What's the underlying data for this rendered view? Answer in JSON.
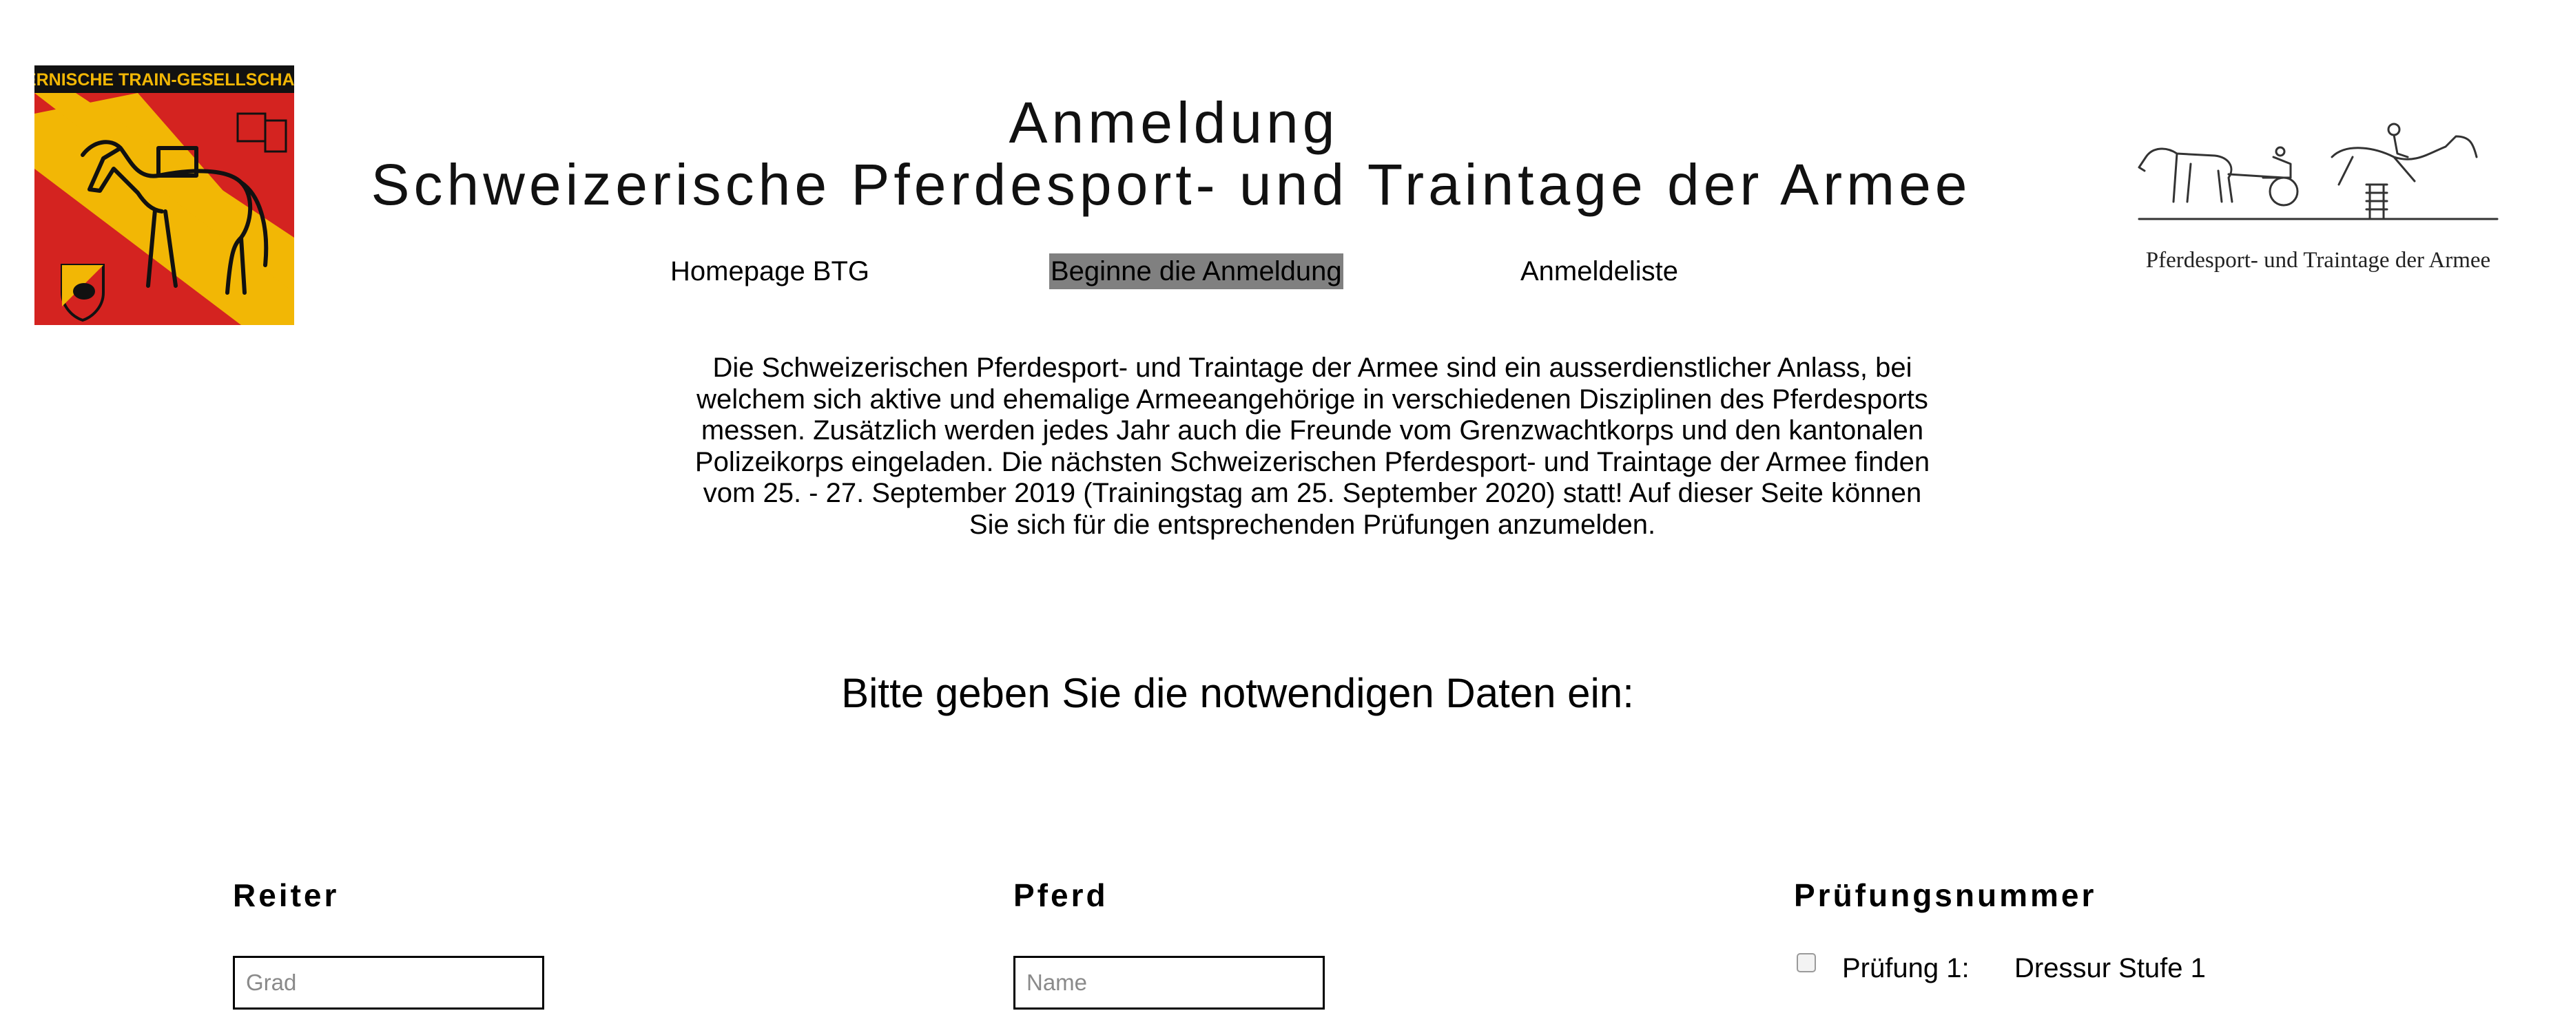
{
  "logo_left": {
    "banner_text": "BERNISCHE TRAIN-GESELLSCHAFT",
    "colors": {
      "red": "#d42320",
      "yellow": "#f2b705",
      "black": "#000000"
    },
    "icon": "horse-logo-icon"
  },
  "logo_right": {
    "caption": "Pferdesport- und Traintage der Armee",
    "icon": "horse-carriage-jumper-icon"
  },
  "header": {
    "title_line_1": "Anmeldung",
    "title_line_2": "Schweizerische Pferdesport- und Traintage der Armee"
  },
  "nav": {
    "homepage": "Homepage BTG",
    "start_registration": "Beginne die Anmeldung",
    "registration_list": "Anmeldeliste",
    "active_highlight_color": "#808080"
  },
  "intro_text": "Die Schweizerischen Pferdesport- und Traintage der Armee sind ein ausserdienstlicher Anlass, bei welchem sich aktive und ehemalige Armeeangehörige in verschiedenen Disziplinen des Pferdesports messen. Zusätzlich werden jedes Jahr auch die Freunde vom Grenzwachtkorps und den kantonalen Polizeikorps eingeladen. Die nächsten Schweizerischen Pferdesport- und Traintage der Armee finden vom 25. - 27. September 2019 (Trainingstag am 25. September 2020) statt! Auf dieser Seite können Sie sich für die entsprechenden Prüfungen anzumelden.",
  "prompt": "Bitte geben Sie die notwendigen Daten ein:",
  "form": {
    "reiter": {
      "heading": "Reiter",
      "grad_placeholder": "Grad",
      "grad_value": ""
    },
    "pferd": {
      "heading": "Pferd",
      "name_placeholder": "Name",
      "name_value": ""
    },
    "pruefungsnummer": {
      "heading": "Prüfungsnummer",
      "items": [
        {
          "label": "Prüfung 1:",
          "discipline": "Dressur Stufe 1",
          "checked": false
        }
      ]
    }
  }
}
